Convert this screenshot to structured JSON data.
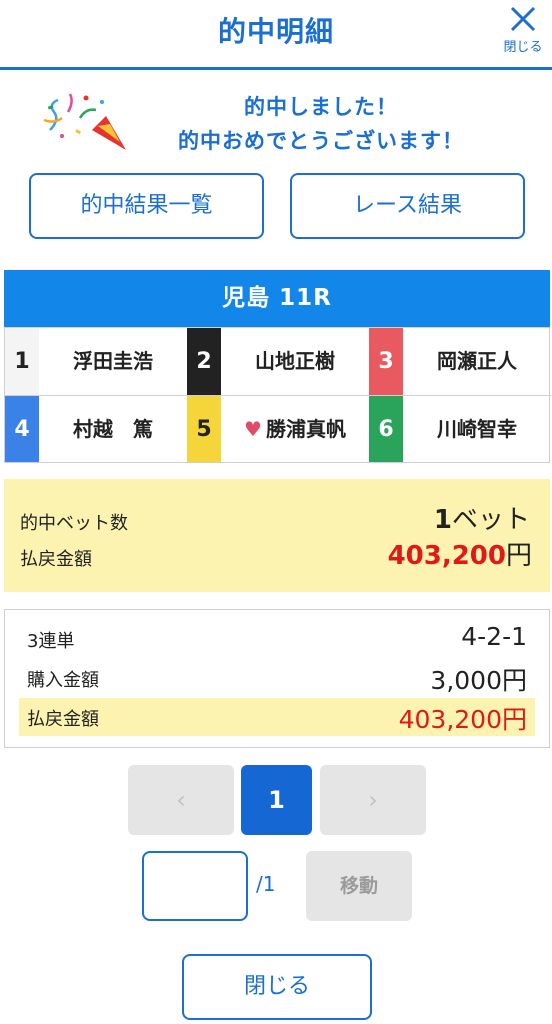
{
  "header": {
    "title": "的中明細",
    "close_label": "閉じる"
  },
  "congrats": {
    "line1": "的中しました！",
    "line2": "的中おめでとうございます！"
  },
  "buttons": {
    "hits_list": "的中結果一覧",
    "race_result": "レース結果",
    "close": "閉じる",
    "move": "移動"
  },
  "race": {
    "title": "児島 11R",
    "racers": [
      {
        "number": "1",
        "name": "浮田圭浩",
        "color": "#f4f4f4"
      },
      {
        "number": "2",
        "name": "山地正樹",
        "color": "#222222"
      },
      {
        "number": "3",
        "name": "岡瀬正人",
        "color": "#e85a60"
      },
      {
        "number": "4",
        "name": "村越　篤",
        "color": "#3b82e8"
      },
      {
        "number": "5",
        "name": "勝浦真帆",
        "color": "#f5d63a",
        "icon": "heart-icon"
      },
      {
        "number": "6",
        "name": "川崎智幸",
        "color": "#2aa45a"
      }
    ]
  },
  "summary": {
    "bet_count_label": "的中ベット数",
    "bet_count": "1",
    "bet_unit": "ベット",
    "payout_label": "払戻金額",
    "payout": "403,200",
    "yen": "円"
  },
  "detail": {
    "type_label": "3連単",
    "combination": "4-2-1",
    "purchase_label": "購入金額",
    "purchase": "3,000円",
    "payout_label": "払戻金額",
    "payout": "403,200円"
  },
  "pager": {
    "prev": "‹",
    "current": "1",
    "next": "›",
    "total": "/1",
    "input_value": ""
  },
  "colors": {
    "accent": "#1a6fd0",
    "highlight": "#fdf3b0",
    "payout_red": "#e01818"
  }
}
